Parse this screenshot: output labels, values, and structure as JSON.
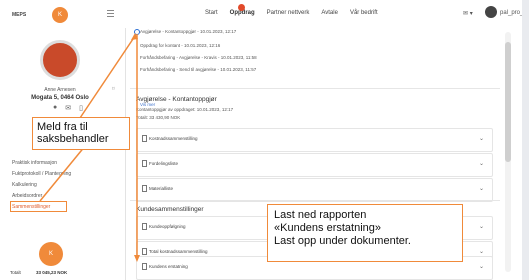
{
  "app": {
    "logo": "MEPS",
    "logo_badge": "K"
  },
  "topnav": {
    "items": [
      "Start",
      "Oppdrag",
      "Partner nettverk",
      "Avtale",
      "Vår bedrift"
    ],
    "selected": "Oppdrag",
    "user": "pal_pro_rebuild"
  },
  "sidebar": {
    "user_name": "Anne Arnesen",
    "address": "Mogata 5, 0464 Oslo",
    "menu": [
      "Praktisk informasjon",
      "Fuktprotokoll / Plantegning",
      "Kalkulering",
      "Arbeidsordrer",
      "Sammenstillinger"
    ],
    "active": "Sammenstillinger",
    "total_left": "Totalt",
    "total": "33 045,23 NOK"
  },
  "timeline": {
    "rows": [
      "Avgjørelse - Kontantoppgjør - 10.01.2023, 12:17",
      "Oppdrag for kontant - 10.01.2023, 12:16",
      "Forhåndsbefaring - Avgjørelse - Kravis - 10.01.2023, 11:58",
      "Forhåndsbefaring - Send til avgjørelse - 10.01.2023, 11:57"
    ],
    "more": "Vis mer"
  },
  "section1": {
    "title": "Avgjørelse - Kontantoppgjør",
    "meta": "Kontantoppgjør av oppdraget: 10.01.2023, 12:17",
    "amount": "Totalt: 33 430,90 NOK",
    "items": [
      "Kostnadssammenstilling",
      "Fordelingsliste",
      "Materialliste"
    ]
  },
  "section2": {
    "title": "Kundesammenstillinger",
    "items": [
      "Kundeoppfølgning",
      "Total kostnadssammenstilling",
      "Kundens erstatning"
    ]
  },
  "callouts": {
    "left": "Meld fra til saksbehandler",
    "right_lines": [
      "Last ned rapporten",
      "«Kundens erstatning»",
      "Last opp under dokumenter."
    ]
  }
}
